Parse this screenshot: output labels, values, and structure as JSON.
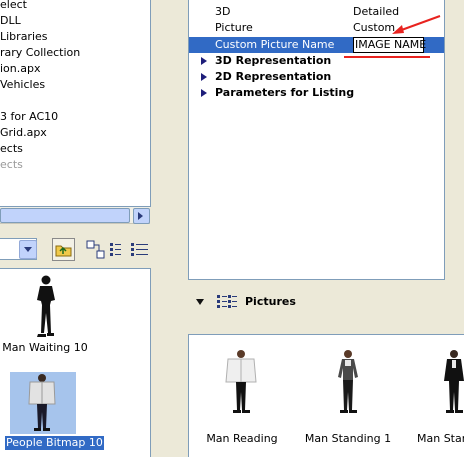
{
  "left_tree": {
    "items": [
      {
        "label": "elect",
        "gray": false
      },
      {
        "label": "DLL",
        "gray": false
      },
      {
        "label": "Libraries",
        "gray": false
      },
      {
        "label": "rary Collection",
        "gray": false
      },
      {
        "label": "ion.apx",
        "gray": false
      },
      {
        "label": "Vehicles",
        "gray": false
      },
      {
        "label": "",
        "gray": false
      },
      {
        "label": "3 for AC10",
        "gray": false
      },
      {
        "label": "Grid.apx",
        "gray": false
      },
      {
        "label": "ects",
        "gray": false
      },
      {
        "label": "ects",
        "gray": true
      }
    ]
  },
  "left_objects": [
    {
      "label": "Man Waiting 10",
      "selected": false
    },
    {
      "label": "People Bitmap 10",
      "selected": true
    }
  ],
  "properties": {
    "rows": [
      {
        "name": "3D",
        "value": "Detailed"
      },
      {
        "name": "Picture",
        "value": "Custom"
      },
      {
        "name": "Custom Picture Name",
        "value": "IMAGE NAME"
      }
    ],
    "groups": [
      "3D Representation",
      "2D Representation",
      "Parameters for Listing"
    ]
  },
  "pictures_section": {
    "title": "Pictures",
    "items": [
      "Man Reading",
      "Man Standing 1",
      "Man Standi"
    ]
  },
  "colors": {
    "selection": "#316ac5",
    "annotation": "#e8231f"
  }
}
